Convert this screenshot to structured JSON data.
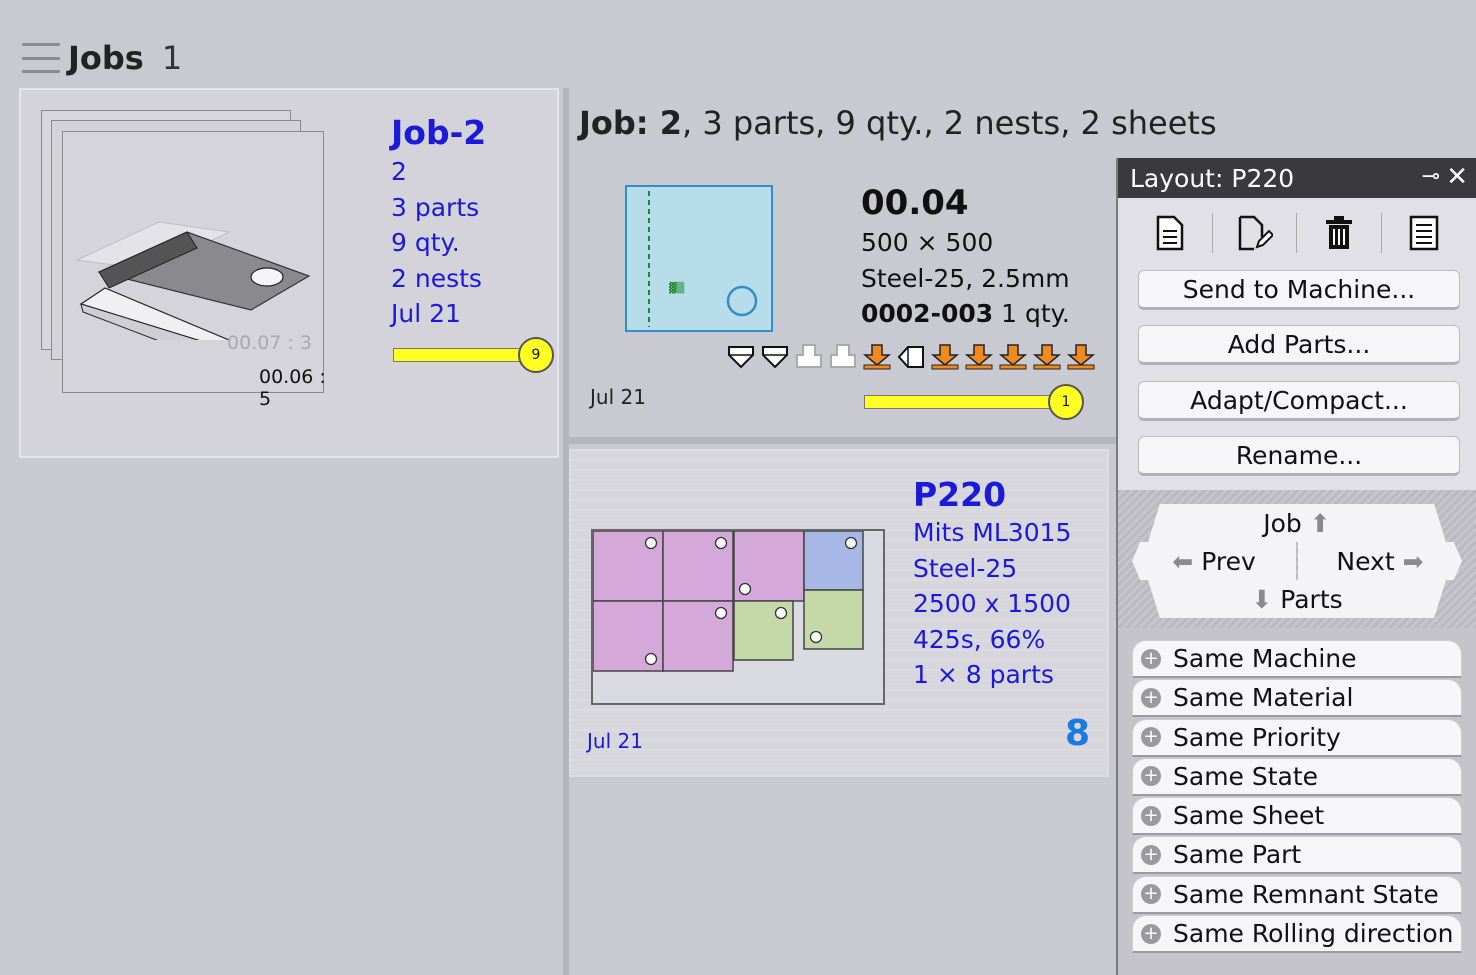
{
  "header": {
    "title": "Jobs",
    "count": "1"
  },
  "job_card": {
    "name": "Job-2",
    "lines": [
      "2",
      "3 parts",
      "9 qty.",
      "2 nests",
      "Jul 21"
    ],
    "thumb_ghost_label": "00.07 : 3",
    "thumb_label": "00.06 : 5",
    "progress_badge": "9",
    "progress": 1.0
  },
  "summary": {
    "prefix": "Job: ",
    "number": "2",
    "rest": ", 3 parts, 9 qty., 2 nests, 2 sheets"
  },
  "part": {
    "code": "00.04",
    "size": "500 × 500",
    "material": "Steel-25, 2.5mm",
    "ref": "0002-003",
    "qty": " 1 qty.",
    "date": "Jul 21",
    "progress_badge": "1",
    "progress": 1.0
  },
  "layout_card": {
    "name": "P220",
    "lines": [
      "Mits ML3015",
      "Steel-25",
      "2500 x 1500",
      "425s, 66%",
      "1 × 8 parts"
    ],
    "date": "Jul 21",
    "qty": "8"
  },
  "panel": {
    "title_prefix": "Layout: ",
    "title_value": "P220",
    "buttons": [
      "Send to Machine...",
      "Add Parts...",
      "Adapt/Compact...",
      "Rename..."
    ],
    "nav": {
      "job": "Job",
      "prev": "Prev",
      "next": "Next",
      "parts": "Parts"
    },
    "filters": [
      "Same Machine",
      "Same Material",
      "Same Priority",
      "Same State",
      "Same Sheet",
      "Same Part",
      "Same Remnant State",
      "Same Rolling direction"
    ]
  },
  "colors": {
    "link_blue": "#1a1adb",
    "orange_icon": "#f08a1e",
    "progress_yellow": "#ffff22",
    "panel_title_bg": "#3a3a3e"
  }
}
